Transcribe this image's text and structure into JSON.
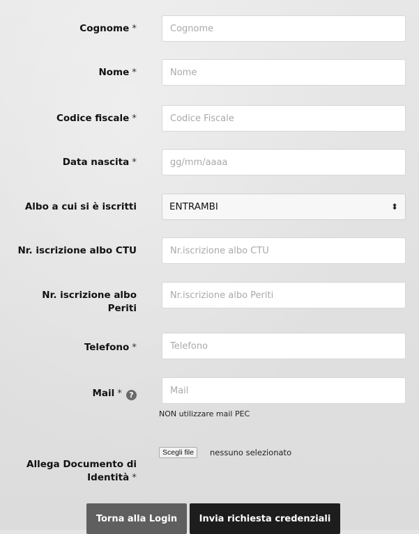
{
  "form": {
    "cognome": {
      "label": "Cognome",
      "required": "*",
      "placeholder": "Cognome"
    },
    "nome": {
      "label": "Nome",
      "required": "*",
      "placeholder": "Nome"
    },
    "codice_fiscale": {
      "label": "Codice fiscale",
      "required": "*",
      "placeholder": "Codice Fiscale"
    },
    "data_nascita": {
      "label": "Data nascita",
      "required": "*",
      "placeholder": "gg/mm/aaaa"
    },
    "albo": {
      "label": "Albo a cui si è iscritti",
      "value": "ENTRAMBI"
    },
    "nr_ctu": {
      "label": "Nr. iscrizione albo CTU",
      "placeholder": "Nr.iscrizione albo CTU"
    },
    "nr_periti": {
      "label_line1": "Nr. iscrizione albo",
      "label_line2": "Periti",
      "placeholder": "Nr.iscrizione albo Periti"
    },
    "telefono": {
      "label": "Telefono",
      "required": "*",
      "placeholder": "Telefono"
    },
    "mail": {
      "label": "Mail",
      "required": "*",
      "placeholder": "Mail",
      "note": "NON utilizzare mail PEC",
      "help_glyph": "?"
    },
    "documento": {
      "label_line1": "Allega Documento di",
      "label_line2": "Identità",
      "required": "*",
      "file_button": "Scegli file",
      "file_status": "nessuno selezionato"
    }
  },
  "buttons": {
    "back": "Torna alla Login",
    "send": "Invia richiesta credenziali"
  },
  "icons": {
    "select_arrows": "⬍",
    "help": "question-circle"
  }
}
